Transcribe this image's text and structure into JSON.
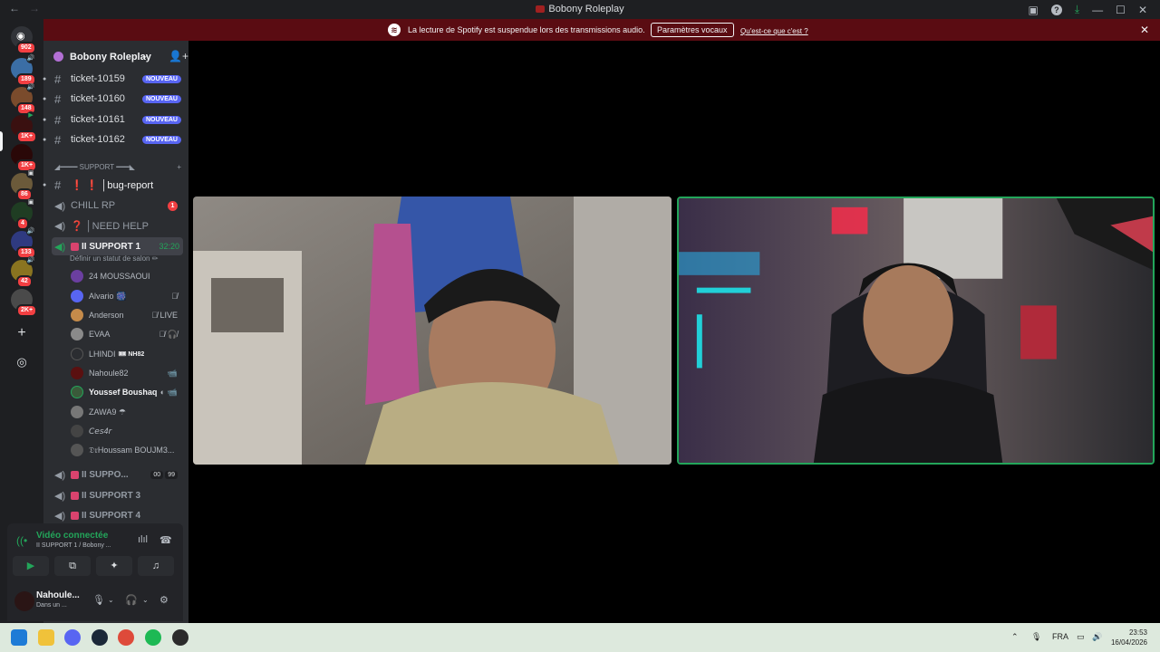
{
  "window": {
    "title": "Bobony Roleplay"
  },
  "banner": {
    "message": "La lecture de Spotify est suspendue lors des transmissions audio.",
    "button": "Paramètres vocaux",
    "link": "Qu'est-ce que c'est ?"
  },
  "guild_badges": [
    "902",
    "189",
    "148",
    "1K+",
    "1K+",
    "86",
    "4",
    "133",
    "42",
    "2K+"
  ],
  "guild": {
    "name": "Bobony Roleplay"
  },
  "tickets": [
    {
      "name": "ticket-10159",
      "badge": "NOUVEAU"
    },
    {
      "name": "ticket-10160",
      "badge": "NOUVEAU"
    },
    {
      "name": "ticket-10161",
      "badge": "NOUVEAU"
    },
    {
      "name": "ticket-10162",
      "badge": "NOUVEAU"
    }
  ],
  "category": {
    "label": "◢━━━━ SUPPORT ━━━◣",
    "add": "+"
  },
  "channels": {
    "bug_report": "❗ ❗ │bug-report",
    "chill_rp": "CHILL RP",
    "chill_rp_mentions": "1",
    "need_help": "❓ │NEED HELP",
    "support1": "II SUPPORT 1",
    "support1_timer": "32:20",
    "support1_status": "Définir un statut de salon ✏",
    "support_trunc": "II SUPPO...",
    "support_trunc_count_a": "00",
    "support_trunc_count_b": "99",
    "support3": "II SUPPORT 3",
    "support4": "II SUPPORT 4"
  },
  "members": [
    {
      "name": "24 MOUSSAOUI",
      "icons": ""
    },
    {
      "name": "Alvario 🎆",
      "icons": "🎙̸"
    },
    {
      "name": "Anderson",
      "icons": "🎙̸ LIVE"
    },
    {
      "name": "EVAA",
      "icons": "🎙̸ 🎧̸"
    },
    {
      "name": "LHINDI",
      "tag": "🎟 NH82",
      "icons": ""
    },
    {
      "name": "Nahoule82",
      "icons": "📹"
    },
    {
      "name": "Youssef Boushaq",
      "icons": "◐ 📹"
    },
    {
      "name": "ZAWA9 ☂",
      "icons": ""
    },
    {
      "name": "𝘊𝘦𝘴4𝘳",
      "icons": ""
    },
    {
      "name": "𝔇𝔯Houssam BOUJM3...",
      "icons": ""
    }
  ],
  "voice": {
    "status": "Vidéo connectée",
    "channel": "II SUPPORT 1 / Bobony ..."
  },
  "user": {
    "name": "Nahoule...",
    "status": "Dans un ..."
  },
  "taskbar": {
    "lang": "FRA",
    "time": "23:53",
    "date": "16/04/2026"
  },
  "colors": {
    "accent_green": "#23a55a",
    "banner_bg": "#5a0c12",
    "badge_blue": "#5865f2",
    "mention_red": "#f23f42"
  }
}
